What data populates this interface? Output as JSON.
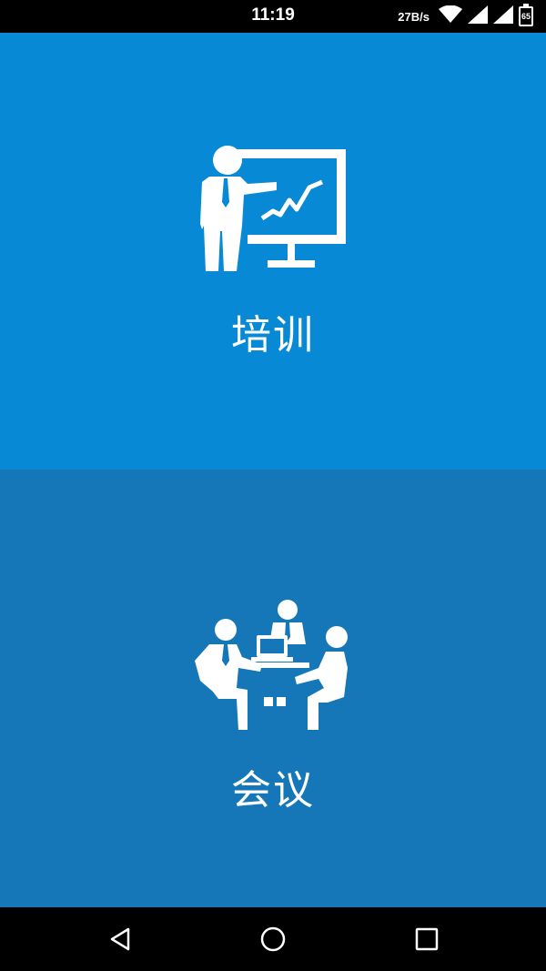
{
  "status_bar": {
    "time": "11:19",
    "net_speed": "27B/s",
    "battery_level": "65",
    "icons": [
      "wifi-icon",
      "signal-icon",
      "signal-icon",
      "battery-icon"
    ]
  },
  "panels": [
    {
      "id": "training",
      "label": "培训",
      "icon": "presentation-icon",
      "background": "#0789d5"
    },
    {
      "id": "meeting",
      "label": "会议",
      "icon": "meeting-icon",
      "background": "#1577b7"
    }
  ],
  "nav_bar": {
    "buttons": [
      "back-icon",
      "home-icon",
      "recent-apps-icon"
    ]
  },
  "colors": {
    "training_bg": "#0789d5",
    "meeting_bg": "#1577b7",
    "bars": "#000000",
    "foreground": "#ffffff"
  }
}
